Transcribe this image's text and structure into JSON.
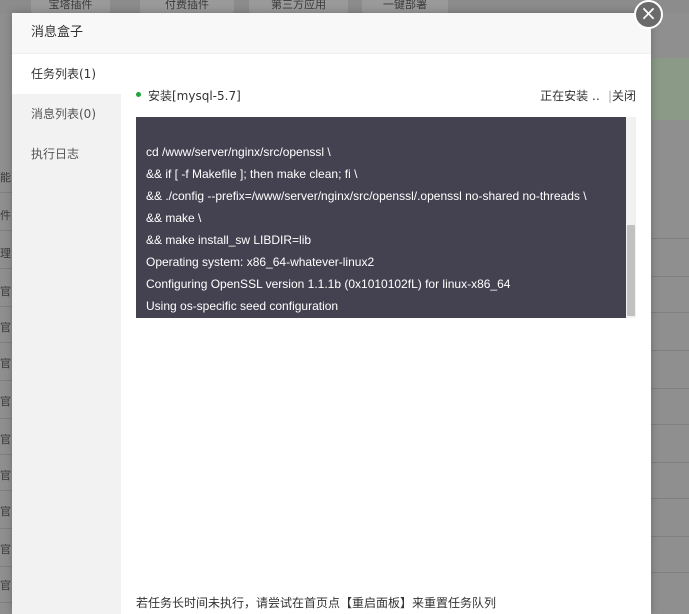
{
  "background": {
    "tabs": [
      "宝塔插件",
      "付费插件",
      "第三方应用",
      "一键部署"
    ],
    "left_chars": [
      "能",
      "件",
      "理",
      "官",
      "官",
      "官",
      "官",
      "官",
      "官",
      "官",
      "官",
      "官"
    ]
  },
  "modal": {
    "title": "消息盒子",
    "close_glyph": "×"
  },
  "sidebar": {
    "items": [
      {
        "label": "任务列表(1)",
        "active": true
      },
      {
        "label": "消息列表(0)",
        "active": false
      },
      {
        "label": "执行日志",
        "active": false
      }
    ]
  },
  "task": {
    "name": "安装[mysql-5.7]",
    "status": "正在安装 ‥",
    "separator": "|",
    "close_label": "关闭",
    "status_color": "#20a53a"
  },
  "console": {
    "lines": [
      "cd /www/server/nginx/src/openssl \\",
      "&& if [ -f Makefile ]; then make clean; fi \\",
      "&& ./config --prefix=/www/server/nginx/src/openssl/.openssl no-shared no-threads \\",
      "&& make \\",
      "&& make install_sw LIBDIR=lib",
      "Operating system: x86_64-whatever-linux2",
      "Configuring OpenSSL version 1.1.1b (0x1010102fL) for linux-x86_64",
      "Using os-specific seed configuration"
    ]
  },
  "footer": {
    "note": "若任务长时间未执行，请尝试在首页点【重启面板】来重置任务队列"
  }
}
